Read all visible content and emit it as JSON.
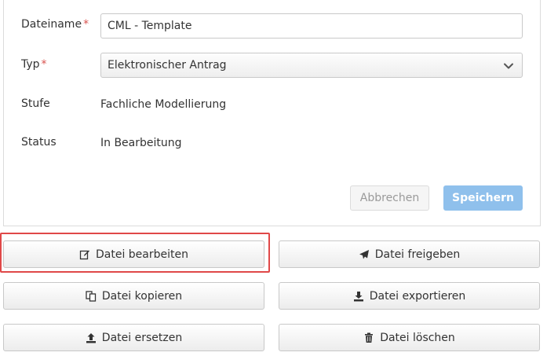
{
  "form": {
    "filename_label": "Dateiname",
    "filename_value": "CML - Template",
    "type_label": "Typ",
    "type_value": "Elektronischer Antrag",
    "stage_label": "Stufe",
    "stage_value": "Fachliche Modellierung",
    "status_label": "Status",
    "status_value": "In Bearbeitung",
    "required_marker": "*",
    "cancel_label": "Abbrechen",
    "save_label": "Speichern"
  },
  "actions": {
    "edit_label": "Datei bearbeiten",
    "release_label": "Datei freigeben",
    "copy_label": "Datei kopieren",
    "export_label": "Datei exportieren",
    "replace_label": "Datei ersetzen",
    "delete_label": "Datei löschen"
  },
  "colors": {
    "required": "#d9534f",
    "primary": "#8fc0ec",
    "highlight": "#e04848"
  },
  "icons": {
    "edit": "edit-icon",
    "release": "paper-plane-icon",
    "copy": "copy-icon",
    "export": "download-icon",
    "replace": "upload-icon",
    "delete": "trash-icon",
    "select": "chevron-down-icon"
  }
}
